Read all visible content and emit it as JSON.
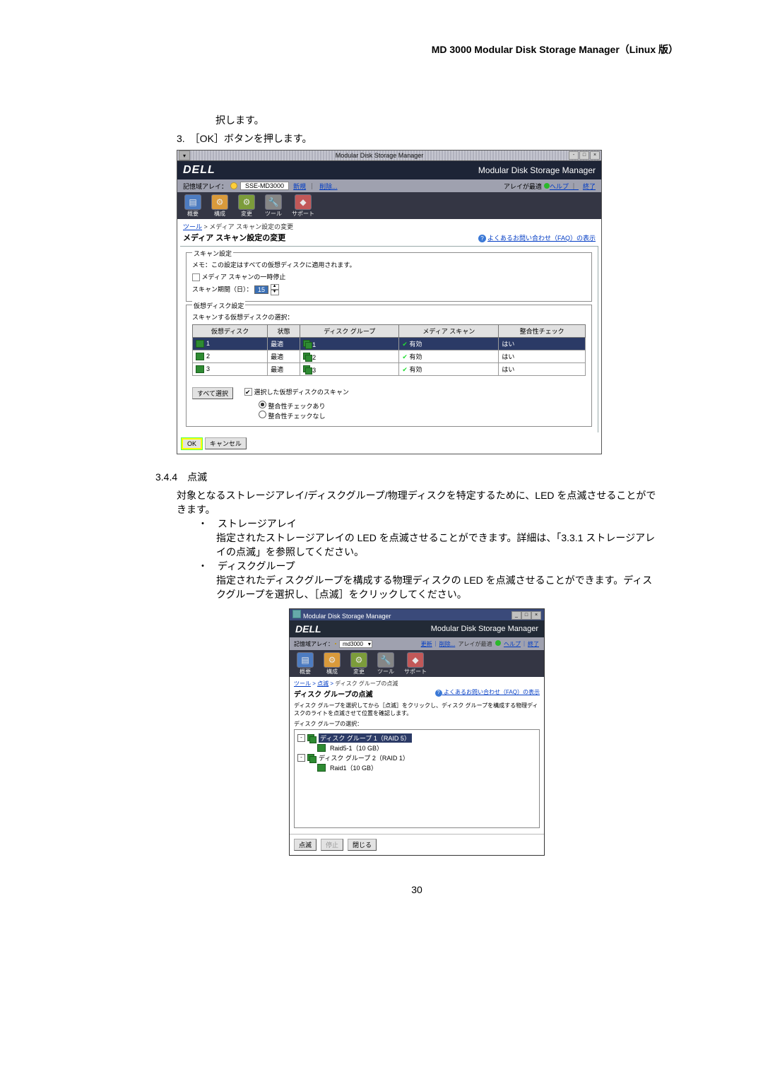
{
  "header": "MD 3000 Modular Disk Storage Manager（Linux 版）",
  "intro": {
    "line1": "択します。",
    "step3": "3.　［OK］ボタンを押します。"
  },
  "ss1": {
    "titlebar_center": "Modular Disk Storage Manager",
    "brand": "DELL",
    "brand_right": "Modular Disk Storage Manager",
    "subbar_label": "記憶域アレイ：",
    "array_name": "SSE-MD3000",
    "subbar_new": "新規",
    "subbar_del": "削除...",
    "status_label": "アレイが最適",
    "help_link": "ヘルプ",
    "exit_link": "終了",
    "tb": {
      "t1": "概要",
      "t2": "構成",
      "t3": "変更",
      "t4": "ツール",
      "t5": "サポート"
    },
    "breadcrumb_tool": "ツール",
    "breadcrumb_sep": " > ",
    "breadcrumb_rest": "メディア スキャン設定の変更",
    "heading": "メディア スキャン設定の変更",
    "faq": "よくあるお問い合わせ（FAQ）の表示",
    "scan_legend": "スキャン設定",
    "note": "メモ：この設定はすべての仮想ディスクに適用されます。",
    "suspend": "メディア スキャンの一時停止",
    "duration": "スキャン期間（日）：",
    "duration_val": "15",
    "vd_legend": "仮想ディスク設定",
    "vd_select_lbl": "スキャンする仮想ディスクの選択：",
    "th": {
      "c1": "仮想ディスク",
      "c2": "状態",
      "c3": "ディスク グループ",
      "c4": "メディア スキャン",
      "c5": "整合性チェック"
    },
    "rows": [
      {
        "vd": "1",
        "status": "最適",
        "dg": "1",
        "scan": "有効",
        "cc": "はい",
        "sel": true
      },
      {
        "vd": "2",
        "status": "最適",
        "dg": "2",
        "scan": "有効",
        "cc": "はい",
        "sel": false
      },
      {
        "vd": "3",
        "status": "最適",
        "dg": "3",
        "scan": "有効",
        "cc": "はい",
        "sel": false
      }
    ],
    "select_all": "すべて選択",
    "scan_sel": "選択した仮想ディスクのスキャン",
    "r_cc_on": "整合性チェックあり",
    "r_cc_off": "整合性チェックなし",
    "ok": "OK",
    "cancel": "キャンセル"
  },
  "section": {
    "num": "3.4.4　点滅",
    "p1": "対象となるストレージアレイ/ディスクグループ/物理ディスクを特定するために、LED を点滅させることができます。",
    "b1_title": "ストレージアレイ",
    "b1_body": "指定されたストレージアレイの LED を点滅させることができます。詳細は、「3.3.1 ストレージアレイの点滅」を参照してください。",
    "b2_title": "ディスクグループ",
    "b2_body": "指定されたディスクグループを構成する物理ディスクの LED を点滅させることができます。ディスクグループを選択し、［点滅］をクリックしてください。"
  },
  "ss2": {
    "titlebar": "Modular Disk Storage Manager",
    "brand": "DELL",
    "brand_right": "Modular Disk Storage Manager",
    "subbar_label": "記憶域アレイ：",
    "array": "md3000",
    "links": {
      "upd": "更新",
      "del": "削除...",
      "stat": "アレイが最適",
      "help": "ヘルプ",
      "exit": "終了"
    },
    "tb": {
      "t1": "概要",
      "t2": "構成",
      "t3": "変更",
      "t4": "ツール",
      "t5": "サポート"
    },
    "bc": {
      "a": "ツール",
      "b": "点滅",
      "c": "ディスク グループの点滅"
    },
    "heading": "ディスク グループの点滅",
    "faq": "よくあるお問い合わせ（FAQ）の表示",
    "desc": "ディスク グループを選択してから［点滅］をクリックし、ディスク グループを構成する物理ディスクのライトを点滅させて位置を確認します。",
    "tree_label": "ディスク グループの選択：",
    "node1": "ディスク グループ 1（RAID 5）",
    "node1a": "Raid5-1（10 GB）",
    "node2": "ディスク グループ 2（RAID 1）",
    "node2a": "Raid1（10 GB）",
    "blink": "点滅",
    "stop": "停止",
    "close": "閉じる"
  },
  "page_num": "30"
}
